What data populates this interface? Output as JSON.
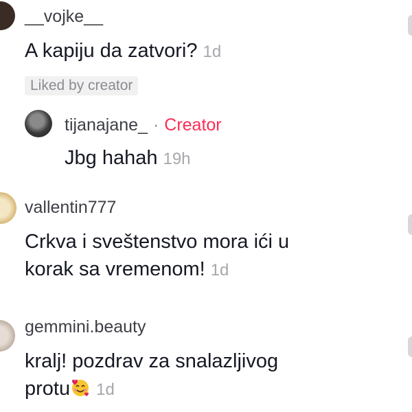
{
  "comments": [
    {
      "username": "__vojke__",
      "text": "A kapiju da zatvori?",
      "time": "1d",
      "badge": "Liked by creator",
      "reply": {
        "username": "tijanajane_",
        "separator": "·",
        "role": "Creator",
        "text": "Jbg hahah",
        "time": "19h"
      }
    },
    {
      "username": "vallentin777",
      "text_line1": "Crkva i sveštenstvo mora ići u",
      "text_line2": "korak sa vremenom!",
      "time": "1d"
    },
    {
      "username": "gemmini.beauty",
      "text_line1": "kralj! pozdrav za snalazljivog",
      "text_line2": "protu",
      "time": "1d",
      "emoji": "smiling-face-with-hearts-icon"
    }
  ],
  "colors": {
    "creator": "#fe2c55",
    "text": "#161823",
    "muted": "#a5a7ab"
  }
}
